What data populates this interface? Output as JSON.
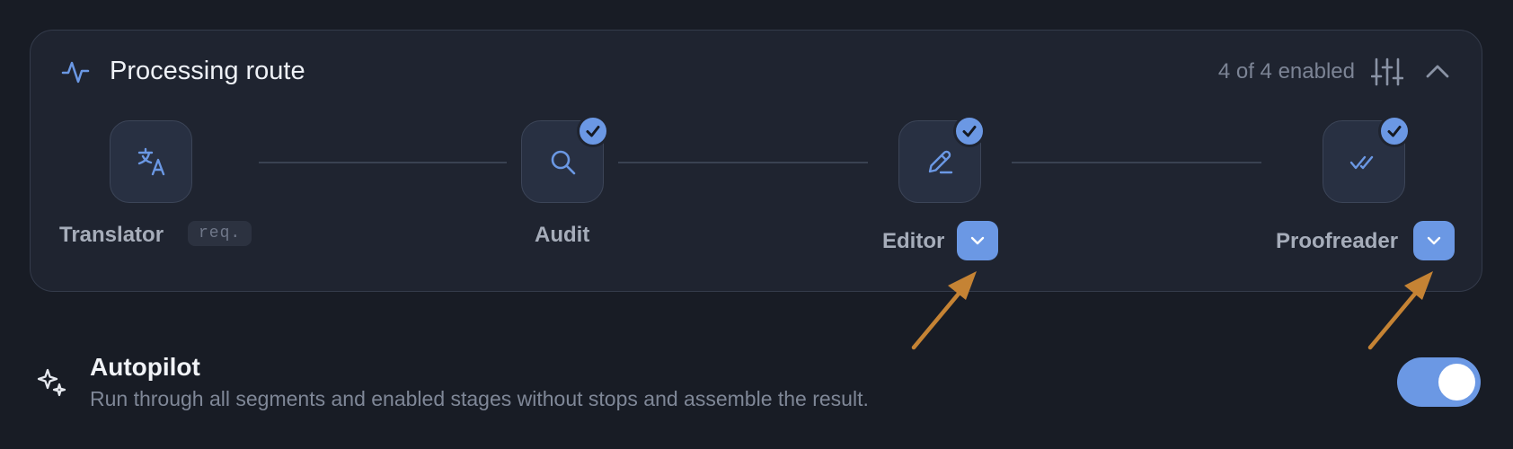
{
  "header": {
    "title": "Processing route",
    "status": "4 of 4 enabled",
    "icons": {
      "route": "activity-pulse-icon",
      "settings": "sliders-icon",
      "collapse": "chevron-up-icon"
    }
  },
  "stages": [
    {
      "label": "Translator",
      "badge": "req.",
      "icon": "translate-icon",
      "checked": false,
      "has_dropdown": false
    },
    {
      "label": "Audit",
      "icon": "search-icon",
      "checked": true,
      "has_dropdown": false
    },
    {
      "label": "Editor",
      "icon": "pencil-icon",
      "checked": true,
      "has_dropdown": true
    },
    {
      "label": "Proofreader",
      "icon": "double-check-icon",
      "checked": true,
      "has_dropdown": true
    }
  ],
  "autopilot": {
    "title": "Autopilot",
    "description": "Run through all segments and enabled stages without stops and assemble the result.",
    "enabled": true,
    "icon": "sparkles-icon"
  },
  "colors": {
    "background": "#181c25",
    "panel": "#1f2430",
    "accent": "#6b98e4",
    "annotation_arrow": "#c58334"
  }
}
